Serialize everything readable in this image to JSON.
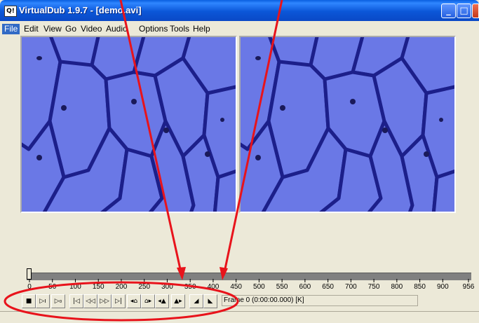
{
  "window": {
    "app_icon_text": "Q!",
    "title": "VirtualDub 1.9.7 - [demo.avi]",
    "buttons": {
      "minimize": "_",
      "maximize": "□",
      "close": "✕"
    }
  },
  "menu": [
    "File",
    "Edit",
    "View",
    "Go",
    "Video",
    "Audio",
    "Options",
    "Tools",
    "Help"
  ],
  "timeline": {
    "tick_labels": [
      "0",
      "50",
      "100",
      "150",
      "200",
      "250",
      "300",
      "350",
      "400",
      "450",
      "500",
      "550",
      "600",
      "650",
      "700",
      "750",
      "800",
      "850",
      "900",
      "956"
    ],
    "position_fraction": 0
  },
  "toolbar": {
    "buttons": [
      {
        "name": "stop-button",
        "glyph": "■"
      },
      {
        "name": "play-input-button",
        "glyph": "▷ı"
      },
      {
        "name": "play-output-button",
        "glyph": "▷₀"
      },
      {
        "name": "go-start-button",
        "glyph": "|◁"
      },
      {
        "name": "step-back-button",
        "glyph": "◁◁"
      },
      {
        "name": "step-forward-button",
        "glyph": "▷▷"
      },
      {
        "name": "go-end-button",
        "glyph": "▷|"
      },
      {
        "name": "prev-keyframe-button",
        "glyph": "◂⌂"
      },
      {
        "name": "next-keyframe-button",
        "glyph": "⌂▸"
      },
      {
        "name": "prev-scene-button",
        "glyph": "◂▲"
      },
      {
        "name": "next-scene-button",
        "glyph": "▲▸"
      },
      {
        "name": "mark-in-button",
        "glyph": "◢"
      },
      {
        "name": "mark-out-button",
        "glyph": "◣"
      }
    ],
    "frame_info": "Frame 0 (0:00:00.000) [K]"
  },
  "colors": {
    "annotation": "#e8131b",
    "cell_fill": "#5d6bde",
    "cell_membrane": "#1c1f8a"
  }
}
